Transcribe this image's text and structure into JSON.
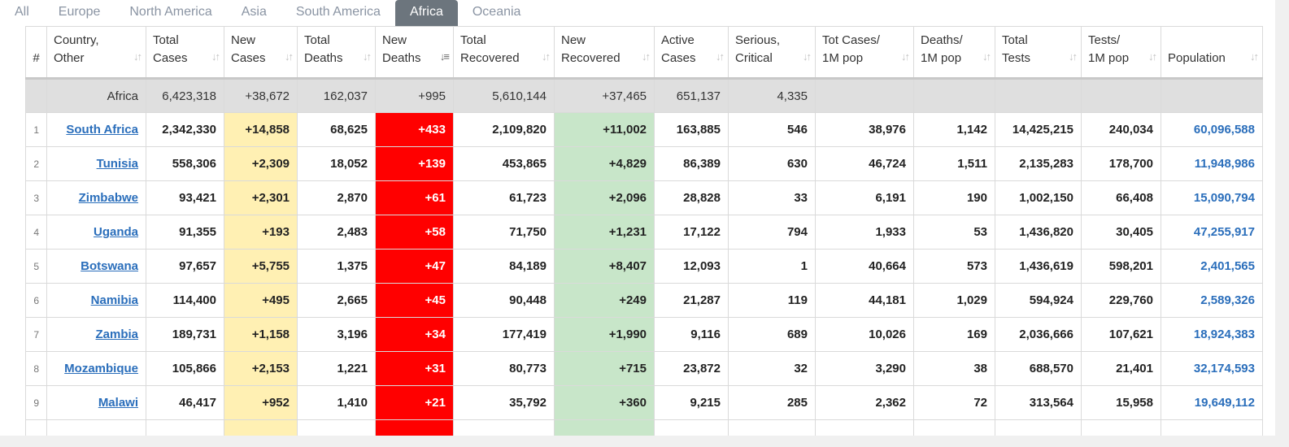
{
  "tabs": [
    {
      "label": "All",
      "active": false
    },
    {
      "label": "Europe",
      "active": false
    },
    {
      "label": "North America",
      "active": false
    },
    {
      "label": "Asia",
      "active": false
    },
    {
      "label": "South America",
      "active": false
    },
    {
      "label": "Africa",
      "active": true
    },
    {
      "label": "Oceania",
      "active": false
    }
  ],
  "colors": {
    "active_tab": "#6c757d",
    "link": "#2a6ebb",
    "new_cases_bg": "#fff0b3",
    "new_deaths_bg": "#ff0000",
    "new_recovered_bg": "#c8e6c9",
    "total_row_bg": "#dfdfdf"
  },
  "table": {
    "headers": [
      {
        "key": "rank",
        "lines": [
          "#"
        ],
        "sortable": false
      },
      {
        "key": "country",
        "lines": [
          "Country,",
          "Other"
        ],
        "sortable": true
      },
      {
        "key": "total_cases",
        "lines": [
          "Total",
          "Cases"
        ],
        "sortable": true
      },
      {
        "key": "new_cases",
        "lines": [
          "New",
          "Cases"
        ],
        "sortable": true
      },
      {
        "key": "total_deaths",
        "lines": [
          "Total",
          "Deaths"
        ],
        "sortable": true
      },
      {
        "key": "new_deaths",
        "lines": [
          "New",
          "Deaths"
        ],
        "sortable": true,
        "sort_active": true,
        "sort_icon": "sort-descending-icon"
      },
      {
        "key": "total_recovered",
        "lines": [
          "Total",
          "Recovered"
        ],
        "sortable": true
      },
      {
        "key": "new_recovered",
        "lines": [
          "New",
          "Recovered"
        ],
        "sortable": true
      },
      {
        "key": "active_cases",
        "lines": [
          "Active",
          "Cases"
        ],
        "sortable": true
      },
      {
        "key": "serious_critical",
        "lines": [
          "Serious,",
          "Critical"
        ],
        "sortable": true
      },
      {
        "key": "tot_cases_1m",
        "lines": [
          "Tot Cases/",
          "1M pop"
        ],
        "sortable": true
      },
      {
        "key": "deaths_1m",
        "lines": [
          "Deaths/",
          "1M pop"
        ],
        "sortable": true
      },
      {
        "key": "total_tests",
        "lines": [
          "Total",
          "Tests"
        ],
        "sortable": true
      },
      {
        "key": "tests_1m",
        "lines": [
          "Tests/",
          "1M pop"
        ],
        "sortable": true
      },
      {
        "key": "population",
        "lines": [
          "",
          "Population"
        ],
        "sortable": true
      }
    ],
    "total_row": {
      "country": "Africa",
      "total_cases": "6,423,318",
      "new_cases": "+38,672",
      "total_deaths": "162,037",
      "new_deaths": "+995",
      "total_recovered": "5,610,144",
      "new_recovered": "+37,465",
      "active_cases": "651,137",
      "serious_critical": "4,335",
      "tot_cases_1m": "",
      "deaths_1m": "",
      "total_tests": "",
      "tests_1m": "",
      "population": ""
    },
    "rows": [
      {
        "rank": "1",
        "country": "South Africa",
        "total_cases": "2,342,330",
        "new_cases": "+14,858",
        "total_deaths": "68,625",
        "new_deaths": "+433",
        "total_recovered": "2,109,820",
        "new_recovered": "+11,002",
        "active_cases": "163,885",
        "serious_critical": "546",
        "tot_cases_1m": "38,976",
        "deaths_1m": "1,142",
        "total_tests": "14,425,215",
        "tests_1m": "240,034",
        "population": "60,096,588"
      },
      {
        "rank": "2",
        "country": "Tunisia",
        "total_cases": "558,306",
        "new_cases": "+2,309",
        "total_deaths": "18,052",
        "new_deaths": "+139",
        "total_recovered": "453,865",
        "new_recovered": "+4,829",
        "active_cases": "86,389",
        "serious_critical": "630",
        "tot_cases_1m": "46,724",
        "deaths_1m": "1,511",
        "total_tests": "2,135,283",
        "tests_1m": "178,700",
        "population": "11,948,986"
      },
      {
        "rank": "3",
        "country": "Zimbabwe",
        "total_cases": "93,421",
        "new_cases": "+2,301",
        "total_deaths": "2,870",
        "new_deaths": "+61",
        "total_recovered": "61,723",
        "new_recovered": "+2,096",
        "active_cases": "28,828",
        "serious_critical": "33",
        "tot_cases_1m": "6,191",
        "deaths_1m": "190",
        "total_tests": "1,002,150",
        "tests_1m": "66,408",
        "population": "15,090,794"
      },
      {
        "rank": "4",
        "country": "Uganda",
        "total_cases": "91,355",
        "new_cases": "+193",
        "total_deaths": "2,483",
        "new_deaths": "+58",
        "total_recovered": "71,750",
        "new_recovered": "+1,231",
        "active_cases": "17,122",
        "serious_critical": "794",
        "tot_cases_1m": "1,933",
        "deaths_1m": "53",
        "total_tests": "1,436,820",
        "tests_1m": "30,405",
        "population": "47,255,917"
      },
      {
        "rank": "5",
        "country": "Botswana",
        "total_cases": "97,657",
        "new_cases": "+5,755",
        "total_deaths": "1,375",
        "new_deaths": "+47",
        "total_recovered": "84,189",
        "new_recovered": "+8,407",
        "active_cases": "12,093",
        "serious_critical": "1",
        "tot_cases_1m": "40,664",
        "deaths_1m": "573",
        "total_tests": "1,436,619",
        "tests_1m": "598,201",
        "population": "2,401,565"
      },
      {
        "rank": "6",
        "country": "Namibia",
        "total_cases": "114,400",
        "new_cases": "+495",
        "total_deaths": "2,665",
        "new_deaths": "+45",
        "total_recovered": "90,448",
        "new_recovered": "+249",
        "active_cases": "21,287",
        "serious_critical": "119",
        "tot_cases_1m": "44,181",
        "deaths_1m": "1,029",
        "total_tests": "594,924",
        "tests_1m": "229,760",
        "population": "2,589,326"
      },
      {
        "rank": "7",
        "country": "Zambia",
        "total_cases": "189,731",
        "new_cases": "+1,158",
        "total_deaths": "3,196",
        "new_deaths": "+34",
        "total_recovered": "177,419",
        "new_recovered": "+1,990",
        "active_cases": "9,116",
        "serious_critical": "689",
        "tot_cases_1m": "10,026",
        "deaths_1m": "169",
        "total_tests": "2,036,666",
        "tests_1m": "107,621",
        "population": "18,924,383"
      },
      {
        "rank": "8",
        "country": "Mozambique",
        "total_cases": "105,866",
        "new_cases": "+2,153",
        "total_deaths": "1,221",
        "new_deaths": "+31",
        "total_recovered": "80,773",
        "new_recovered": "+715",
        "active_cases": "23,872",
        "serious_critical": "32",
        "tot_cases_1m": "3,290",
        "deaths_1m": "38",
        "total_tests": "688,570",
        "tests_1m": "21,401",
        "population": "32,174,593"
      },
      {
        "rank": "9",
        "country": "Malawi",
        "total_cases": "46,417",
        "new_cases": "+952",
        "total_deaths": "1,410",
        "new_deaths": "+21",
        "total_recovered": "35,792",
        "new_recovered": "+360",
        "active_cases": "9,215",
        "serious_critical": "285",
        "tot_cases_1m": "2,362",
        "deaths_1m": "72",
        "total_tests": "313,564",
        "tests_1m": "15,958",
        "population": "19,649,112"
      }
    ]
  }
}
